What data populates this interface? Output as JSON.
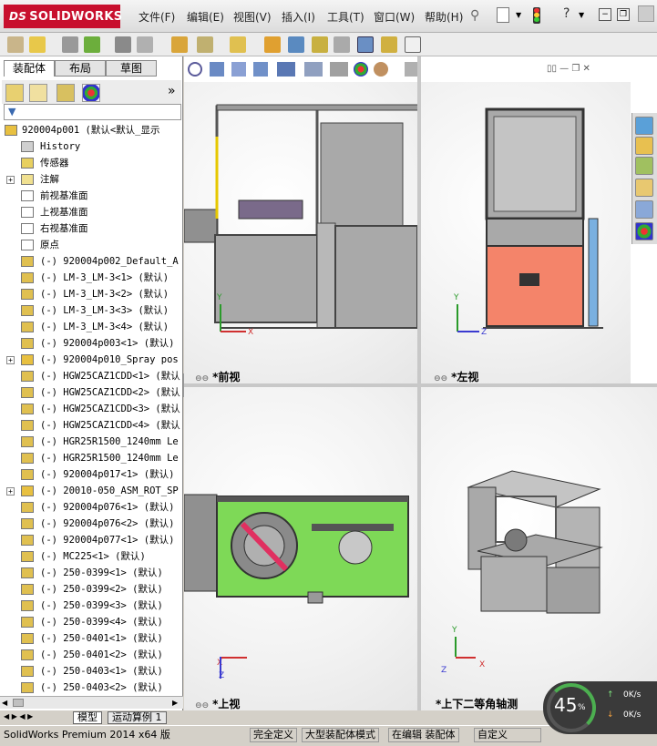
{
  "app": {
    "logo_ds": "DS",
    "logo_text": "SOLIDWORKS"
  },
  "menu": [
    "文件(F)",
    "编辑(E)",
    "视图(V)",
    "插入(I)",
    "工具(T)",
    "窗口(W)",
    "帮助(H)"
  ],
  "window_controls": {
    "help": "?",
    "minimize": "−",
    "restore": "❐"
  },
  "left_panel": {
    "tabs": [
      "装配体",
      "布局",
      "草图"
    ],
    "active_tab": "装配体",
    "expand_glyph": "»",
    "tree": [
      {
        "label": "920004p001  (默认<默认_显示",
        "expand": "",
        "icon": "assembly",
        "root": true
      },
      {
        "label": "History",
        "expand": "",
        "icon": "history"
      },
      {
        "label": "传感器",
        "expand": "",
        "icon": "sensor"
      },
      {
        "label": "注解",
        "expand": "+",
        "icon": "annotation"
      },
      {
        "label": "前视基准面",
        "expand": "",
        "icon": "plane"
      },
      {
        "label": "上视基准面",
        "expand": "",
        "icon": "plane"
      },
      {
        "label": "右视基准面",
        "expand": "",
        "icon": "plane"
      },
      {
        "label": "原点",
        "expand": "",
        "icon": "origin"
      },
      {
        "label": "(-) 920004p002_Default_A",
        "expand": "",
        "icon": "part"
      },
      {
        "label": "(-) LM-3_LM-3<1> (默认)",
        "expand": "",
        "icon": "part"
      },
      {
        "label": "(-) LM-3_LM-3<2> (默认)",
        "expand": "",
        "icon": "part"
      },
      {
        "label": "(-) LM-3_LM-3<3> (默认)",
        "expand": "",
        "icon": "part"
      },
      {
        "label": "(-) LM-3_LM-3<4> (默认)",
        "expand": "",
        "icon": "part"
      },
      {
        "label": "(-) 920004p003<1> (默认)",
        "expand": "",
        "icon": "part"
      },
      {
        "label": "(-) 920004p010_Spray pos",
        "expand": "+",
        "icon": "assembly"
      },
      {
        "label": "(-) HGW25CAZ1CDD<1> (默认",
        "expand": "",
        "icon": "part"
      },
      {
        "label": "(-) HGW25CAZ1CDD<2> (默认",
        "expand": "",
        "icon": "part"
      },
      {
        "label": "(-) HGW25CAZ1CDD<3> (默认",
        "expand": "",
        "icon": "part"
      },
      {
        "label": "(-) HGW25CAZ1CDD<4> (默认",
        "expand": "",
        "icon": "part"
      },
      {
        "label": "(-) HGR25R1500_1240mm Le",
        "expand": "",
        "icon": "part"
      },
      {
        "label": "(-) HGR25R1500_1240mm Le",
        "expand": "",
        "icon": "part"
      },
      {
        "label": "(-) 920004p017<1> (默认)",
        "expand": "",
        "icon": "part"
      },
      {
        "label": "(-) 20010-050_ASM_ROT_SP",
        "expand": "+",
        "icon": "assembly"
      },
      {
        "label": "(-) 920004p076<1> (默认)",
        "expand": "",
        "icon": "part"
      },
      {
        "label": "(-) 920004p076<2> (默认)",
        "expand": "",
        "icon": "part"
      },
      {
        "label": "(-) 920004p077<1> (默认)",
        "expand": "",
        "icon": "part"
      },
      {
        "label": "(-) MC225<1> (默认)",
        "expand": "",
        "icon": "part"
      },
      {
        "label": "(-) 250-0399<1> (默认)",
        "expand": "",
        "icon": "part"
      },
      {
        "label": "(-) 250-0399<2> (默认)",
        "expand": "",
        "icon": "part"
      },
      {
        "label": "(-) 250-0399<3> (默认)",
        "expand": "",
        "icon": "part"
      },
      {
        "label": "(-) 250-0399<4> (默认)",
        "expand": "",
        "icon": "part"
      },
      {
        "label": "(-) 250-0401<1> (默认)",
        "expand": "",
        "icon": "part"
      },
      {
        "label": "(-) 250-0401<2> (默认)",
        "expand": "",
        "icon": "part"
      },
      {
        "label": "(-) 250-0403<1> (默认)",
        "expand": "",
        "icon": "part"
      },
      {
        "label": "(-) 250-0403<2> (默认)",
        "expand": "",
        "icon": "part"
      }
    ]
  },
  "bottom_tabs": [
    "模型",
    "运动算例 1"
  ],
  "status": {
    "product": "SolidWorks Premium 2014 x64 版",
    "fully_defined": "完全定义",
    "large_assembly": "大型装配体模式",
    "editing": "在编辑 装配体",
    "custom": "自定义"
  },
  "viewports": [
    {
      "label": "*前视",
      "axes": [
        "Y",
        "X"
      ]
    },
    {
      "label": "*左视",
      "axes": [
        "Y",
        "Z"
      ]
    },
    {
      "label": "*上视",
      "axes": [
        "X",
        "Z"
      ]
    },
    {
      "label": "*上下二等角轴测",
      "axes": [
        "Y",
        "Z",
        "X"
      ]
    }
  ],
  "perf": {
    "percent": "45",
    "percent_sign": "%",
    "upload": "0K/s",
    "download": "0K/s"
  },
  "colors": {
    "accent_red": "#c8102e",
    "machine_green": "#7ed957",
    "machine_salmon": "#f4846a",
    "frame_gray": "#a9a9a9"
  }
}
